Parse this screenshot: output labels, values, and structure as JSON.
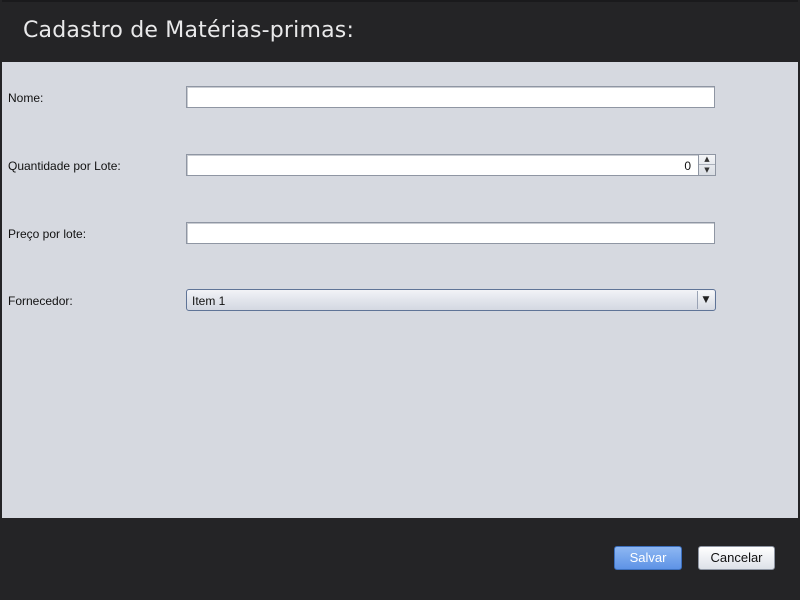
{
  "window": {
    "title": "Cadastro de Matérias-primas:"
  },
  "form": {
    "nome": {
      "label": "Nome:",
      "value": ""
    },
    "quantidade": {
      "label": "Quantidade por Lote:",
      "value": "0"
    },
    "preco": {
      "label": "Preço por lote:",
      "value": ""
    },
    "fornecedor": {
      "label": "Fornecedor:",
      "selected": "Item 1"
    }
  },
  "icons": {
    "spin_up": "▲",
    "spin_down": "▼",
    "dropdown": "▼"
  },
  "footer": {
    "save_label": "Salvar",
    "cancel_label": "Cancelar"
  },
  "colors": {
    "header_bg": "#242426",
    "body_bg": "#d6d9e0",
    "save_accent": "#5e93e6"
  }
}
